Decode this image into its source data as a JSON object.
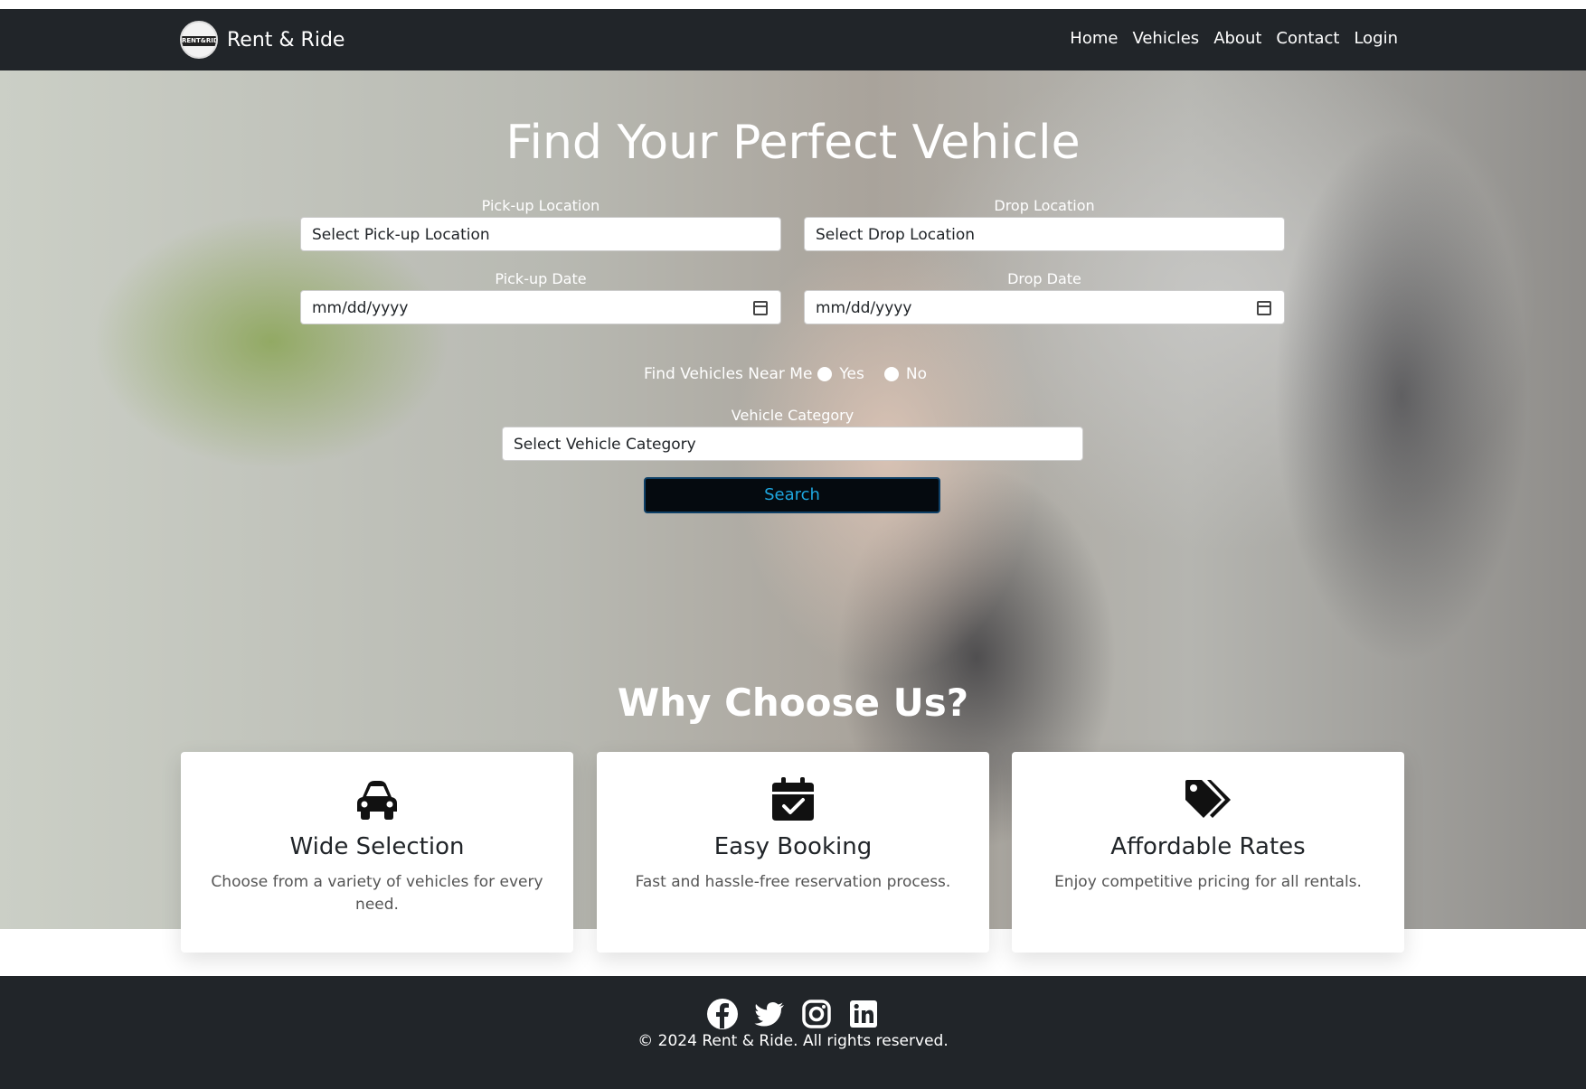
{
  "brand": {
    "name": "Rent & Ride",
    "logo_text": "RENT&RIDE"
  },
  "nav": {
    "home": "Home",
    "vehicles": "Vehicles",
    "about": "About",
    "contact": "Contact",
    "login": "Login"
  },
  "hero": {
    "title": "Find Your Perfect Vehicle",
    "pickup_location": {
      "label": "Pick-up Location",
      "value": "Select Pick-up Location"
    },
    "drop_location": {
      "label": "Drop Location",
      "value": "Select Drop Location"
    },
    "pickup_date": {
      "label": "Pick-up Date",
      "placeholder": "mm/dd/yyyy"
    },
    "drop_date": {
      "label": "Drop Date",
      "placeholder": "mm/dd/yyyy"
    },
    "near_me": {
      "label": "Find Vehicles Near Me",
      "yes": "Yes",
      "no": "No"
    },
    "category": {
      "label": "Vehicle Category",
      "value": "Select Vehicle Category"
    },
    "search_label": "Search"
  },
  "why": {
    "title": "Why Choose Us?",
    "cards": [
      {
        "icon": "car-icon",
        "title": "Wide Selection",
        "desc": "Choose from a variety of vehicles for every need."
      },
      {
        "icon": "calendar-check-icon",
        "title": "Easy Booking",
        "desc": "Fast and hassle-free reservation process."
      },
      {
        "icon": "tags-icon",
        "title": "Affordable Rates",
        "desc": "Enjoy competitive pricing for all rentals."
      }
    ]
  },
  "footer": {
    "social": [
      "facebook-icon",
      "twitter-icon",
      "instagram-icon",
      "linkedin-icon"
    ],
    "copyright": "© 2024 Rent & Ride. All rights reserved."
  },
  "colors": {
    "navbar": "#212529",
    "search_bg": "#050a0f",
    "search_text": "#1ea7e0"
  }
}
